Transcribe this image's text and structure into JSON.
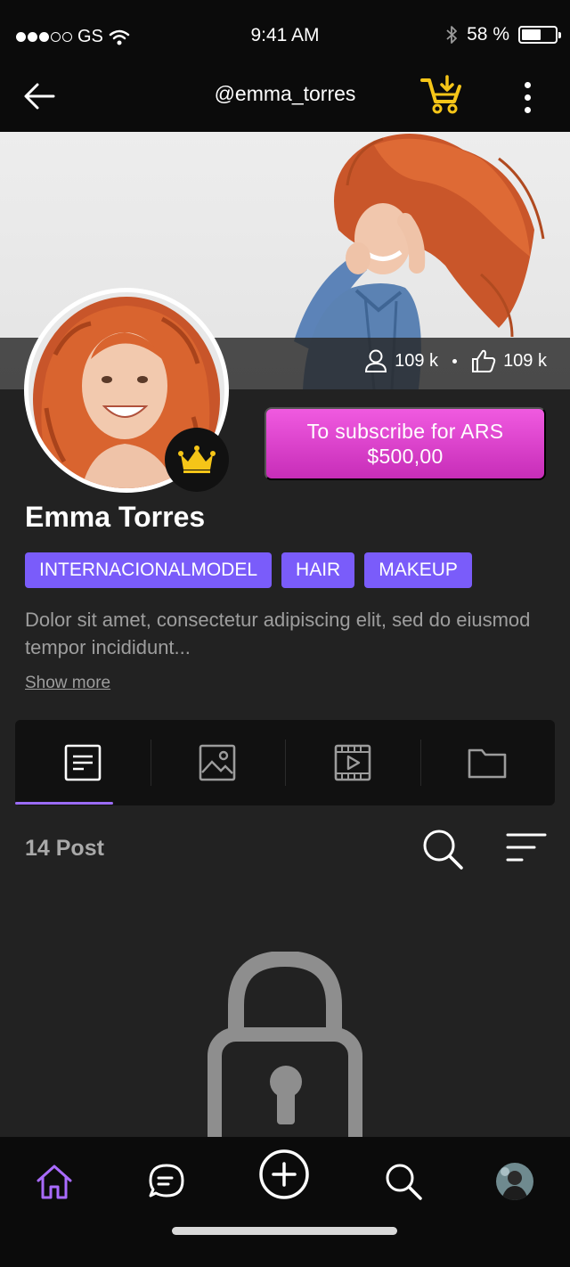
{
  "status_bar": {
    "carrier": "GS",
    "time": "9:41 AM",
    "battery": "58 %",
    "battery_level": 0.58
  },
  "nav": {
    "title": "@emma_torres",
    "icons": {
      "back": "back-arrow-icon",
      "cart": "cart-download-icon",
      "more": "more-vertical-icon"
    },
    "cart_color": "#f5c518"
  },
  "profile": {
    "followers": "109 k",
    "likes": "109 k",
    "subscribe_label": "To subscribe for ARS $500,00",
    "name": "Emma Torres",
    "tags": [
      "INTERNACIONALMODEL",
      "HAIR",
      "MAKEUP"
    ],
    "bio": "Dolor sit amet, consectetur adipiscing elit, sed do eiusmod tempor incididunt...",
    "show_more": "Show more"
  },
  "tabs": [
    {
      "icon": "posts-icon",
      "active": true
    },
    {
      "icon": "image-icon",
      "active": false
    },
    {
      "icon": "video-icon",
      "active": false
    },
    {
      "icon": "folder-icon",
      "active": false
    }
  ],
  "posts": {
    "count_label": "14 Post"
  },
  "bottom_nav": [
    {
      "icon": "home-icon",
      "active": true
    },
    {
      "icon": "chat-icon",
      "active": false
    },
    {
      "icon": "add-icon",
      "active": false
    },
    {
      "icon": "search-icon",
      "active": false
    },
    {
      "icon": "profile-avatar",
      "active": false
    }
  ],
  "colors": {
    "accent_purple": "#7a5cfa",
    "subscribe_pink": "#e046d4",
    "crown_gold": "#f5c518",
    "background": "#222222"
  }
}
